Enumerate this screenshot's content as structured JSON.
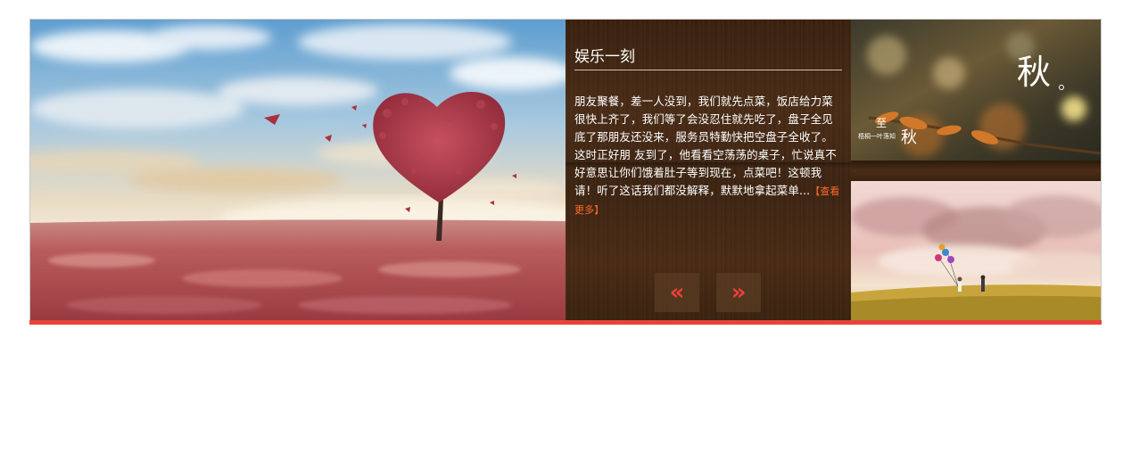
{
  "article": {
    "title": "娱乐一刻",
    "body": "朋友聚餐，差一人没到，我们就先点菜，饭店给力菜很快上齐了，我们等了会没忍住就先吃了，盘子全见底了那朋友还没来，服务员特勤快把空盘子全收了。这时正好朋 友到了，他看看空荡荡的桌子，忙说真不好意思让你们饿着肚子等到现在，点菜吧！这顿我请！听了这话我们都没解释，默默地拿起菜单...",
    "more_label": "【查看更多】"
  },
  "nav": {
    "prev_label": "«",
    "next_label": "»"
  },
  "thumbs": {
    "top_big_text": "秋",
    "top_small_text": "梧桐一叶落知",
    "top_small_char": "秋",
    "top_mark": "至"
  },
  "colors": {
    "accent": "#e8433a",
    "link": "#ff6a2a",
    "panel_bg": "#3d2412"
  }
}
